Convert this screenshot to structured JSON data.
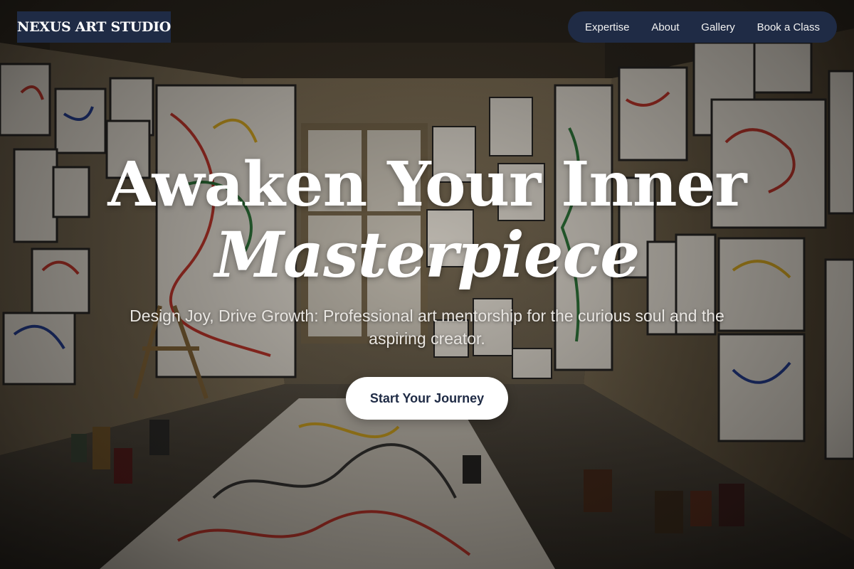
{
  "brand": {
    "logo_text": "NEXUS ART STUDIO"
  },
  "nav": {
    "items": [
      {
        "label": "Expertise"
      },
      {
        "label": "About"
      },
      {
        "label": "Gallery"
      },
      {
        "label": "Book a Class"
      }
    ]
  },
  "hero": {
    "title_line1": "Awaken Your Inner",
    "title_line2": "Masterpiece",
    "subtitle": "Design Joy, Drive Growth: Professional art mentorship for the curious soul and the aspiring creator.",
    "cta_label": "Start Your Journey",
    "background_description_icon": "art-studio-photo"
  },
  "colors": {
    "nav_bg": "#1f2b45",
    "cta_bg": "#ffffff",
    "cta_text": "#1f2b45",
    "text": "#ffffff"
  }
}
